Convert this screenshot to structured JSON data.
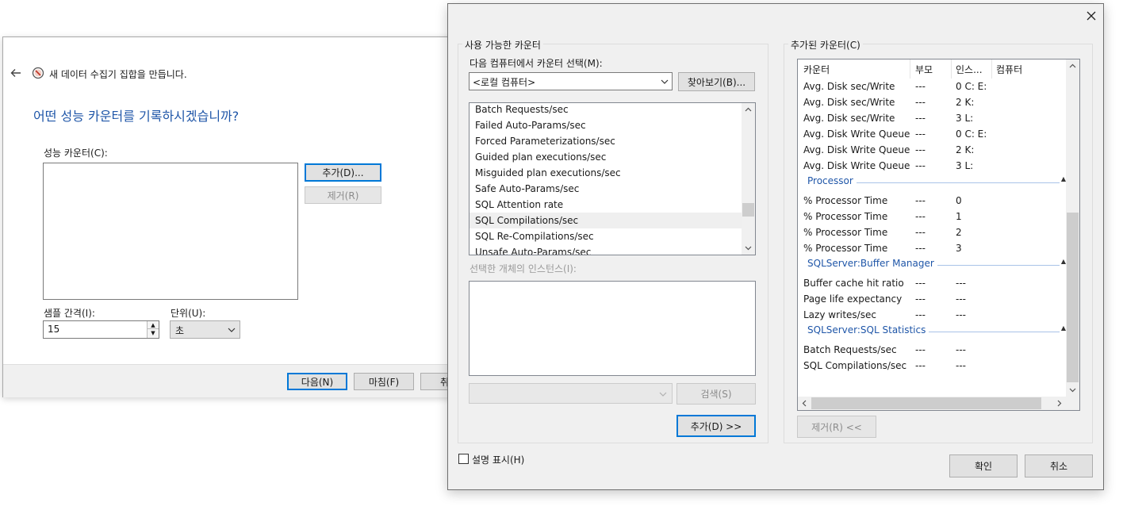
{
  "wizard": {
    "title": "새 데이터 수집기 집합을 만듭니다.",
    "heading": "어떤 성능 카운터를 기록하시겠습니까?",
    "counters_label": "성능 카운터(C):",
    "add_button": "추가(D)...",
    "remove_button": "제거(R)",
    "sample_interval_label": "샘플 간격(I):",
    "sample_interval_value": "15",
    "unit_label": "단위(U):",
    "unit_value": "초",
    "next_button": "다음(N)",
    "finish_button": "마침(F)",
    "cancel_button_partial": "취"
  },
  "dialog": {
    "available_group": "사용 가능한 카운터",
    "select_from_label": "다음 컴퓨터에서 카운터 선택(M):",
    "computer_value": "<로컬 컴퓨터>",
    "browse_button": "찾아보기(B)...",
    "counter_list": [
      "Batch Requests/sec",
      "Failed Auto-Params/sec",
      "Forced Parameterizations/sec",
      "Guided plan executions/sec",
      "Misguided plan executions/sec",
      "Safe Auto-Params/sec",
      "SQL Attention rate",
      "SQL Compilations/sec",
      "SQL Re-Compilations/sec",
      "Unsafe Auto-Params/sec"
    ],
    "hover_index": 7,
    "instances_label": "선택한 개체의 인스턴스(I):",
    "search_button": "검색(S)",
    "add_button": "추가(D) >>",
    "added_group": "추가된 카운터(C)",
    "columns": [
      "카운터",
      "부모",
      "인스...",
      "컴퓨터"
    ],
    "added_rows": [
      {
        "type": "row",
        "counter": "Avg. Disk sec/Write",
        "parent": "---",
        "instance": "0 C: E:",
        "computer": ""
      },
      {
        "type": "row",
        "counter": "Avg. Disk sec/Write",
        "parent": "---",
        "instance": "2 K:",
        "computer": ""
      },
      {
        "type": "row",
        "counter": "Avg. Disk sec/Write",
        "parent": "---",
        "instance": "3 L:",
        "computer": ""
      },
      {
        "type": "row",
        "counter": "Avg. Disk Write Queue...",
        "parent": "---",
        "instance": "0 C: E:",
        "computer": ""
      },
      {
        "type": "row",
        "counter": "Avg. Disk Write Queue...",
        "parent": "---",
        "instance": "2 K:",
        "computer": ""
      },
      {
        "type": "row",
        "counter": "Avg. Disk Write Queue...",
        "parent": "---",
        "instance": "3 L:",
        "computer": ""
      },
      {
        "type": "category",
        "counter": "Processor"
      },
      {
        "type": "row",
        "counter": "% Processor Time",
        "parent": "---",
        "instance": "0",
        "computer": ""
      },
      {
        "type": "row",
        "counter": "% Processor Time",
        "parent": "---",
        "instance": "1",
        "computer": ""
      },
      {
        "type": "row",
        "counter": "% Processor Time",
        "parent": "---",
        "instance": "2",
        "computer": ""
      },
      {
        "type": "row",
        "counter": "% Processor Time",
        "parent": "---",
        "instance": "3",
        "computer": ""
      },
      {
        "type": "category",
        "counter": "SQLServer:Buffer Manager"
      },
      {
        "type": "row",
        "counter": "Buffer cache hit ratio",
        "parent": "---",
        "instance": "---",
        "computer": ""
      },
      {
        "type": "row",
        "counter": "Page life expectancy",
        "parent": "---",
        "instance": "---",
        "computer": ""
      },
      {
        "type": "row",
        "counter": "Lazy writes/sec",
        "parent": "---",
        "instance": "---",
        "computer": ""
      },
      {
        "type": "category",
        "counter": "SQLServer:SQL Statistics"
      },
      {
        "type": "row",
        "counter": "Batch Requests/sec",
        "parent": "---",
        "instance": "---",
        "computer": ""
      },
      {
        "type": "row",
        "counter": "SQL Compilations/sec",
        "parent": "---",
        "instance": "---",
        "computer": ""
      }
    ],
    "remove_button": "제거(R) <<",
    "show_description_label": "설명 표시(H)",
    "ok_button": "확인",
    "cancel_button": "취소"
  },
  "colors": {
    "accent": "#0078d7",
    "heading_blue": "#1f56a8",
    "dialog_bg": "#f0f0f0"
  }
}
